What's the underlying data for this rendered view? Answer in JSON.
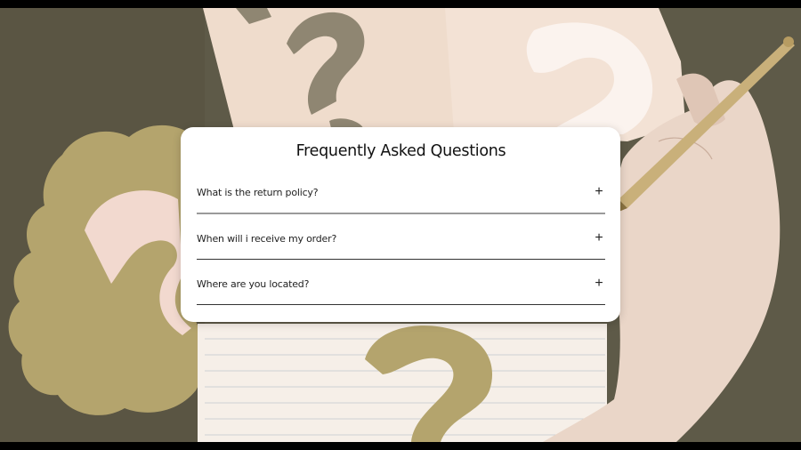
{
  "faq": {
    "title": "Frequently Asked Questions",
    "items": [
      {
        "question": "What is the return policy?",
        "toggle": "+"
      },
      {
        "question": "When will i receive my order?",
        "toggle": "+"
      },
      {
        "question": "Where are you located?",
        "toggle": "+"
      }
    ]
  },
  "background": {
    "icons": [
      "question-mark-icon",
      "pen-icon",
      "hand-icon",
      "thought-bubble-icon",
      "notebook-icon"
    ],
    "colors": {
      "table": "#5e5a48",
      "paper": "#efdccc",
      "olive_cutout": "#b4a46d",
      "taupe_cutout": "#8f8672",
      "pink_cutout": "#f2d9cf",
      "skin": "#ead6c8",
      "pen_gold": "#c9b07a"
    }
  }
}
